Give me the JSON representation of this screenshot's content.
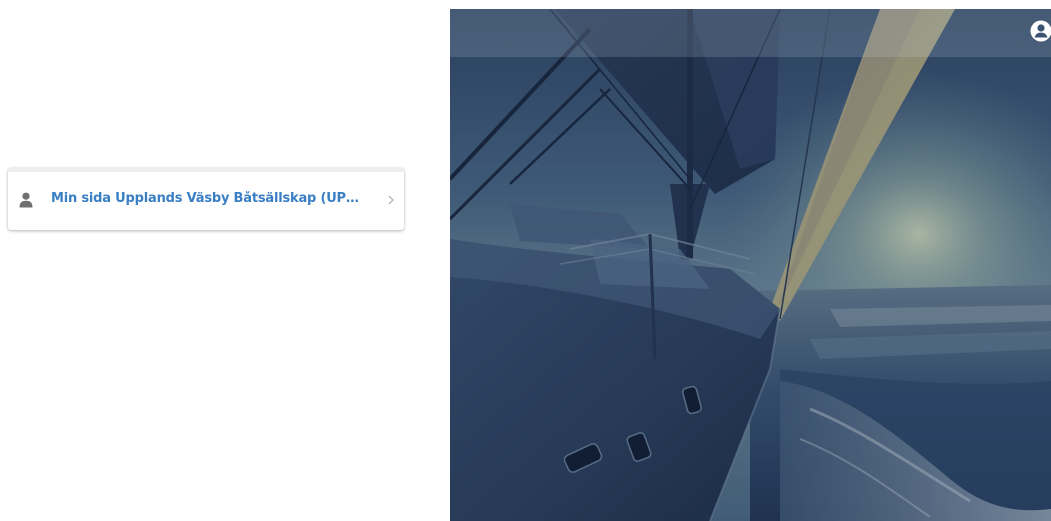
{
  "page_link": {
    "label": "Min sida Upplands Väsby Båtsällskap (UPPLANDS VÄSBY BÅTSÄLLSKAP)",
    "icon": "user-icon",
    "chevron_icon": "chevron-right-icon"
  },
  "header": {
    "account_icon": "account-circle-icon"
  },
  "hero": {
    "image": "sailboat-at-sunset"
  },
  "colors": {
    "link_text": "#3a7fc4",
    "hero_overlay": "#1b2c48"
  }
}
